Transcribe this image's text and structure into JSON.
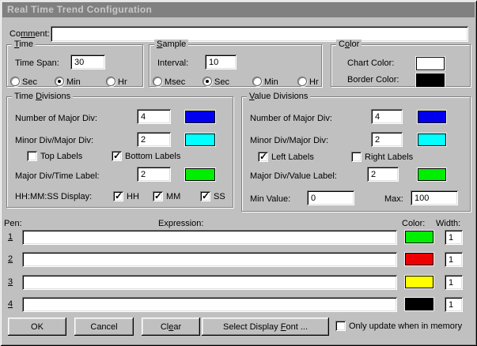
{
  "window": {
    "title": "Real Time Trend Configuration"
  },
  "comment": {
    "label_pre": "Co",
    "label_u": "mm",
    "label_post": "ent:",
    "value": ""
  },
  "time": {
    "title_pre": "",
    "title_u": "T",
    "title_post": "ime",
    "span_label": "Time Span:",
    "span_value": "30",
    "radio_sec": "Sec",
    "radio_min": "Min",
    "radio_hr": "Hr"
  },
  "sample": {
    "title_pre": "",
    "title_u": "S",
    "title_post": "ample",
    "interval_label": "Interval:",
    "interval_value": "10",
    "radio_msec": "Msec",
    "radio_sec": "Sec",
    "radio_min": "Min",
    "radio_hr": "Hr"
  },
  "color": {
    "title_pre": "C",
    "title_u": "o",
    "title_post": "lor",
    "chart_label": "Chart Color:",
    "chart_value": "#ffffff",
    "border_label": "Border Color:",
    "border_value": "#000000"
  },
  "time_divisions": {
    "title_pre": "Time ",
    "title_u": "D",
    "title_post": "ivisions",
    "major_label": "Number of Major Div:",
    "major_value": "4",
    "major_color": "#0000ee",
    "minor_label": "Minor Div/Major Div:",
    "minor_value": "2",
    "minor_color": "#00ffff",
    "top_labels": "Top Labels",
    "bottom_labels": "Bottom Labels",
    "major_time_label": "Major Div/Time Label:",
    "major_time_value": "2",
    "major_time_color": "#00ee00",
    "hhmmss_label": "HH:MM:SS Display:",
    "hh": "HH",
    "mm": "MM",
    "ss": "SS"
  },
  "value_divisions": {
    "title_pre": "",
    "title_u": "V",
    "title_post": "alue Divisions",
    "major_label": "Number of Major Div:",
    "major_value": "4",
    "major_color": "#0000ee",
    "minor_label": "Minor Div/Major Div:",
    "minor_value": "2",
    "minor_color": "#00ffff",
    "left_labels": "Left Labels",
    "right_labels": "Right Labels",
    "major_value_label": "Major Div/Value Label:",
    "major_value_value": "2",
    "major_value_color": "#00ee00",
    "min_label": "Min Value:",
    "min_value": "0",
    "max_label": "Max:",
    "max_value": "100"
  },
  "pens": {
    "pen_header": "Pen:",
    "expression_header": "Expression:",
    "color_header": "Color:",
    "width_header": "Width:",
    "rows": [
      {
        "num": "1",
        "expression": "",
        "color": "#00ee00",
        "width": "1"
      },
      {
        "num": "2",
        "expression": "",
        "color": "#ee0000",
        "width": "1"
      },
      {
        "num": "3",
        "expression": "",
        "color": "#ffff00",
        "width": "1"
      },
      {
        "num": "4",
        "expression": "",
        "color": "#000000",
        "width": "1"
      }
    ]
  },
  "footer": {
    "ok": "OK",
    "cancel": "Cancel",
    "clear_pre": "Cl",
    "clear_u": "e",
    "clear_post": "ar",
    "font_pre": "Select Display ",
    "font_u": "F",
    "font_post": "ont ...",
    "memory_label": "Only update when in memory"
  },
  "states": {
    "time_sec": false,
    "time_min": true,
    "time_hr": false,
    "sample_msec": false,
    "sample_sec": true,
    "sample_min": false,
    "sample_hr": false,
    "top_labels_checked": false,
    "bottom_labels_checked": true,
    "left_labels_checked": true,
    "right_labels_checked": false,
    "hh_checked": true,
    "mm_checked": true,
    "ss_checked": true,
    "memory_checked": false
  }
}
